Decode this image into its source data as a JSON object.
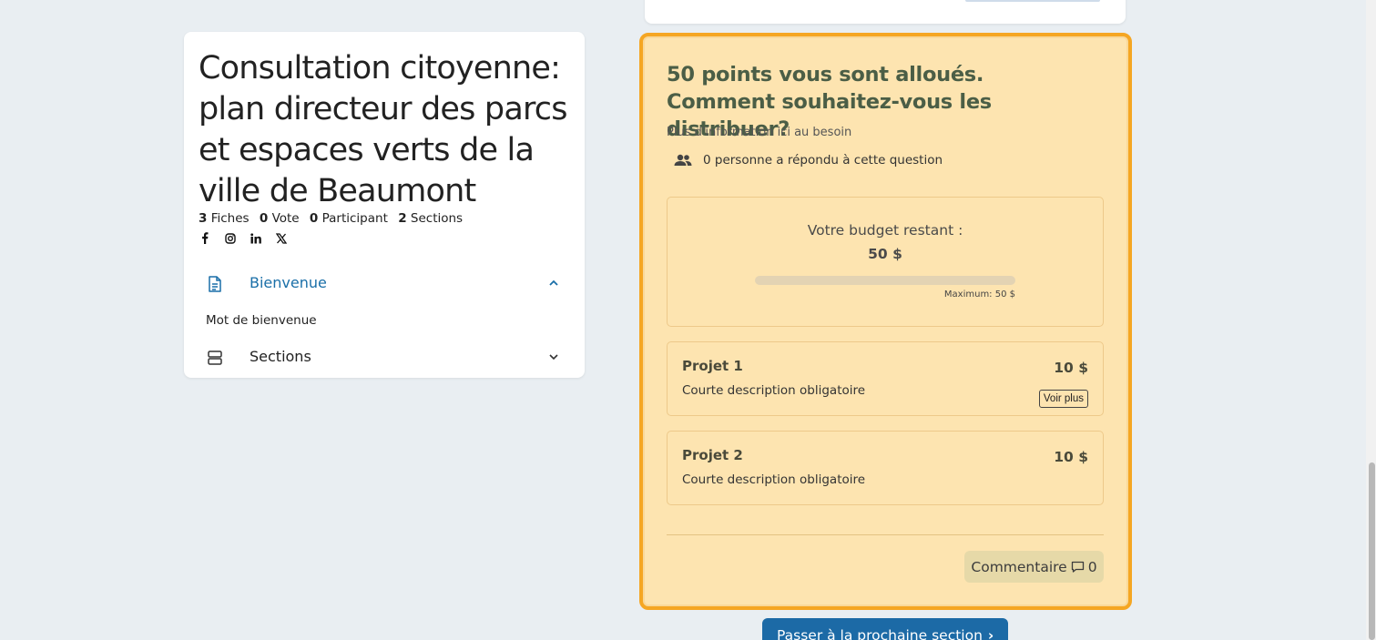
{
  "consultation": {
    "title": "Consultation citoyenne: plan directeur des parcs et espaces verts de la ville de Beaumont",
    "stats": {
      "fiches_count": "3",
      "fiches_label": "Fiches",
      "votes_count": "0",
      "votes_label": "Vote",
      "participants_count": "0",
      "participants_label": "Participant",
      "sections_count": "2",
      "sections_label": "Sections"
    },
    "socials": [
      {
        "icon": "facebook-icon",
        "glyph": "f"
      },
      {
        "icon": "instagram-icon",
        "glyph": "◎"
      },
      {
        "icon": "linkedin-icon",
        "glyph": "in"
      },
      {
        "icon": "x-twitter-icon",
        "glyph": "𝕏"
      }
    ],
    "nav": {
      "bienvenue_label": "Bienvenue",
      "bienvenue_sub": "Mot de bienvenue",
      "sections_label": "Sections"
    }
  },
  "question": {
    "title": "50 points vous sont alloués. Comment souhaitez-vous les distribuer?",
    "info": "Plus d'information ici au besoin",
    "responses": "0 personne a répondu à cette question",
    "budget": {
      "label": "Votre budget restant :",
      "value": "50 $",
      "max_label": "Maximum: 50 $",
      "used_fraction": 0
    },
    "projects": [
      {
        "name": "Projet 1",
        "description": "Courte description obligatoire",
        "amount": "10 $",
        "more_label": "Voir plus"
      },
      {
        "name": "Projet 2",
        "description": "Courte description obligatoire",
        "amount": "10 $"
      }
    ],
    "comment": {
      "label": "Commentaire",
      "count": "0"
    }
  },
  "next_button": {
    "label": "Passer à la prochaine section"
  },
  "colors": {
    "accent": "#1c6aa6",
    "highlight_border": "#f5a623",
    "card_bg": "#fde4b0",
    "page_bg": "#e9eef2"
  }
}
